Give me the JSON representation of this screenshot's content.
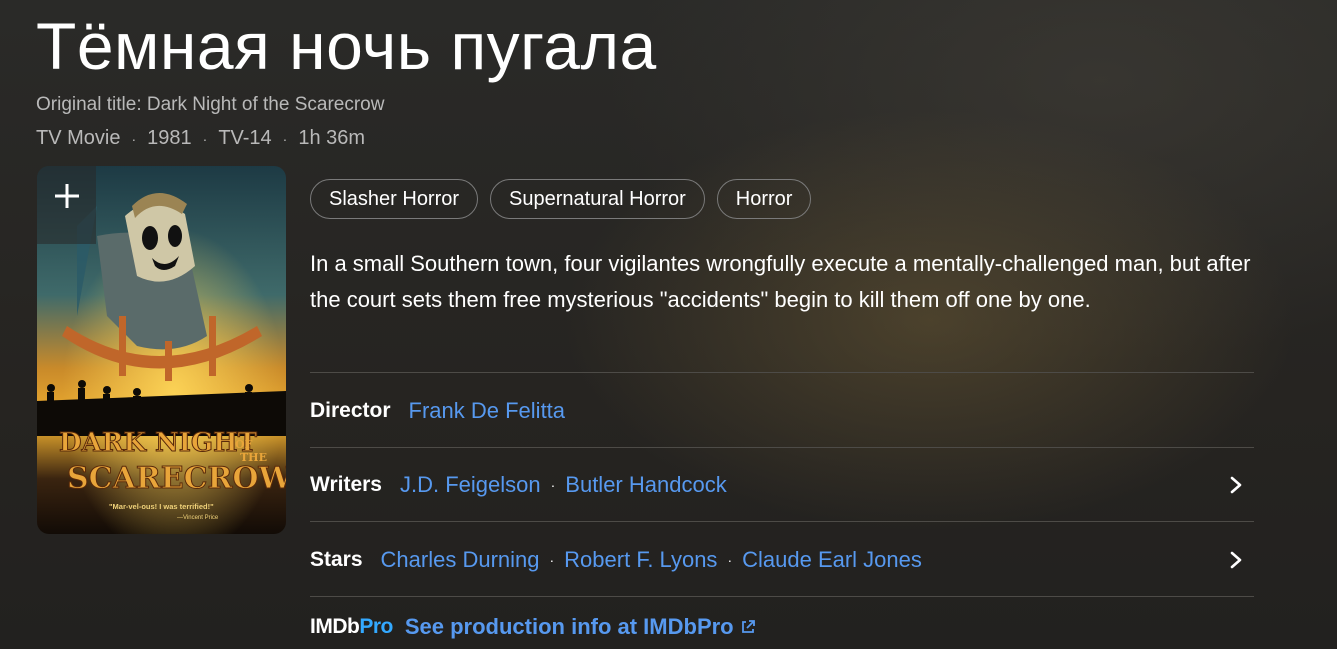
{
  "title": "Тёмная ночь пугала",
  "original_title": "Original title: Dark Night of the Scarecrow",
  "meta": [
    "TV Movie",
    "1981",
    "TV-14",
    "1h 36m"
  ],
  "meta_sep": "·",
  "poster": {
    "title_line1": "DARK NIGHT",
    "title_of": "OF",
    "title_the": "THE",
    "title_line2": "SCARECROW",
    "quote": "\"Mar-vel-ous! I was terrified!\"",
    "quote_author": "—Vincent Price",
    "add_icon": "plus-icon"
  },
  "genres": [
    "Slasher Horror",
    "Supernatural Horror",
    "Horror"
  ],
  "plot": "In a small Southern town, four vigilantes wrongfully execute a mentally-challenged man, but after the court sets them free mysterious \"accidents\" begin to kill them off one by one.",
  "credits": {
    "director": {
      "label": "Director",
      "names": [
        "Frank De Felitta"
      ]
    },
    "writers": {
      "label": "Writers",
      "names": [
        "J.D. Feigelson",
        "Butler Handcock"
      ]
    },
    "stars": {
      "label": "Stars",
      "names": [
        "Charles Durning",
        "Robert F. Lyons",
        "Claude Earl Jones"
      ]
    }
  },
  "imdbpro": {
    "logo_imdb": "IMDb",
    "logo_pro": "Pro",
    "link": "See production info at IMDbPro",
    "icon": "external-link-icon"
  },
  "colors": {
    "link": "#5799ef",
    "pro_accent": "#33a9ff"
  }
}
